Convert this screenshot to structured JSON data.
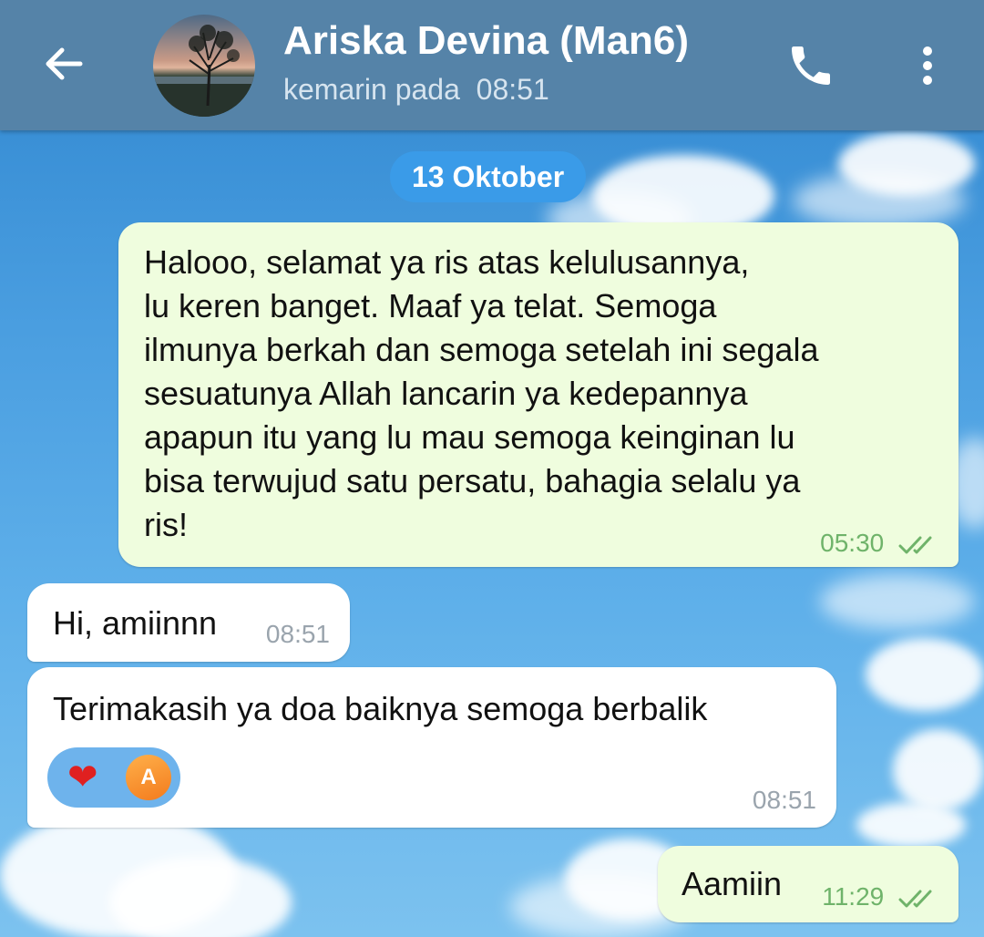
{
  "header": {
    "back_icon": "arrow-left-icon",
    "contact_name": "Ariska Devina (Man6)",
    "last_seen": "kemarin pada  08:51",
    "call_icon": "phone-icon",
    "menu_icon": "more-vertical-icon",
    "colors": {
      "bar": "#5583a8",
      "title": "#ffffff",
      "subtitle": "#d6e4ef"
    }
  },
  "chat": {
    "date_label": "13 Oktober",
    "messages": [
      {
        "direction": "outgoing",
        "text": "Halooo, selamat ya ris atas kelulusannya,\nlu keren banget. Maaf ya telat. Semoga\nilmunya berkah dan semoga setelah ini segala\nsesuatunya Allah lancarin ya kedepannya\napapun itu yang lu mau semoga keinginan lu\nbisa terwujud satu persatu, bahagia selalu ya\nris!",
        "time": "05:30",
        "status": "read"
      },
      {
        "direction": "incoming",
        "text": "Hi, amiinnn",
        "time": "08:51"
      },
      {
        "direction": "incoming",
        "text": "Terimakasih ya doa baiknya semoga berbalik",
        "time": "08:51",
        "reaction": {
          "emoji": "❤",
          "user_initial": "A"
        }
      },
      {
        "direction": "outgoing",
        "text": "Aamiin",
        "time": "11:29",
        "status": "read"
      }
    ],
    "colors": {
      "outgoing_bubble": "#effdde",
      "incoming_bubble": "#ffffff",
      "outgoing_time": "#6fb36a",
      "incoming_time": "#9aa4ad",
      "date_chip": "#3a9be8"
    }
  }
}
